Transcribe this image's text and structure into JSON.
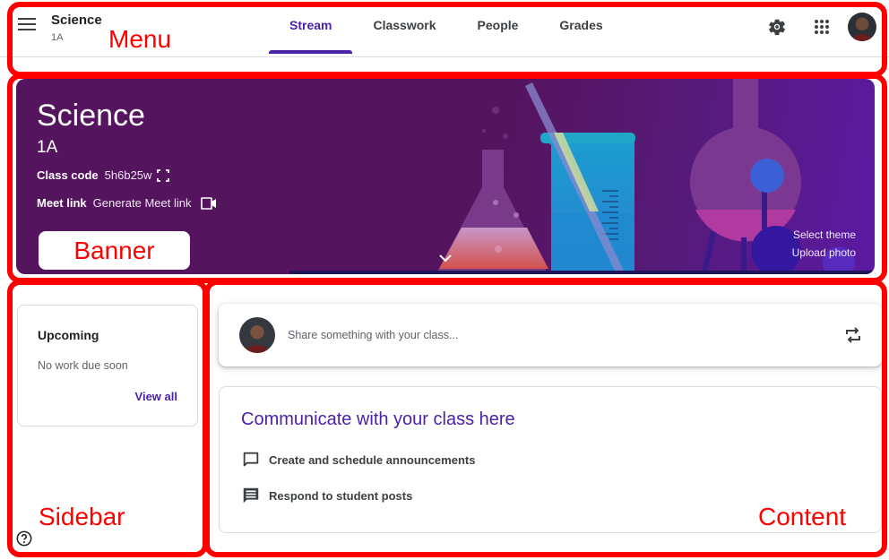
{
  "header": {
    "class_name": "Science",
    "section": "1A",
    "tabs": [
      {
        "label": "Stream",
        "active": true
      },
      {
        "label": "Classwork",
        "active": false
      },
      {
        "label": "People",
        "active": false
      },
      {
        "label": "Grades",
        "active": false
      }
    ],
    "icons": [
      "menu-icon",
      "gear-icon",
      "apps-grid-icon",
      "user-avatar"
    ]
  },
  "banner": {
    "title": "Science",
    "section": "1A",
    "class_code_label": "Class code",
    "class_code": "5h6b25w",
    "meet_label": "Meet link",
    "meet_action": "Generate Meet link",
    "select_theme": "Select theme",
    "upload_photo": "Upload photo",
    "theme_color": "#55145e"
  },
  "sidebar": {
    "upcoming_title": "Upcoming",
    "upcoming_empty": "No work due soon",
    "view_all": "View all"
  },
  "content": {
    "share_placeholder": "Share something with your class...",
    "comm_title": "Communicate with your class here",
    "comm_items": [
      {
        "icon": "comment-outline-icon",
        "label": "Create and schedule announcements"
      },
      {
        "icon": "comment-lines-icon",
        "label": "Respond to student posts"
      }
    ]
  },
  "annotations": {
    "menu": "Menu",
    "banner": "Banner",
    "sidebar": "Sidebar",
    "content": "Content",
    "color": "#ff0000"
  },
  "colors": {
    "accent": "#4b21a5",
    "text_primary": "#202124",
    "text_secondary": "#5f6368"
  }
}
